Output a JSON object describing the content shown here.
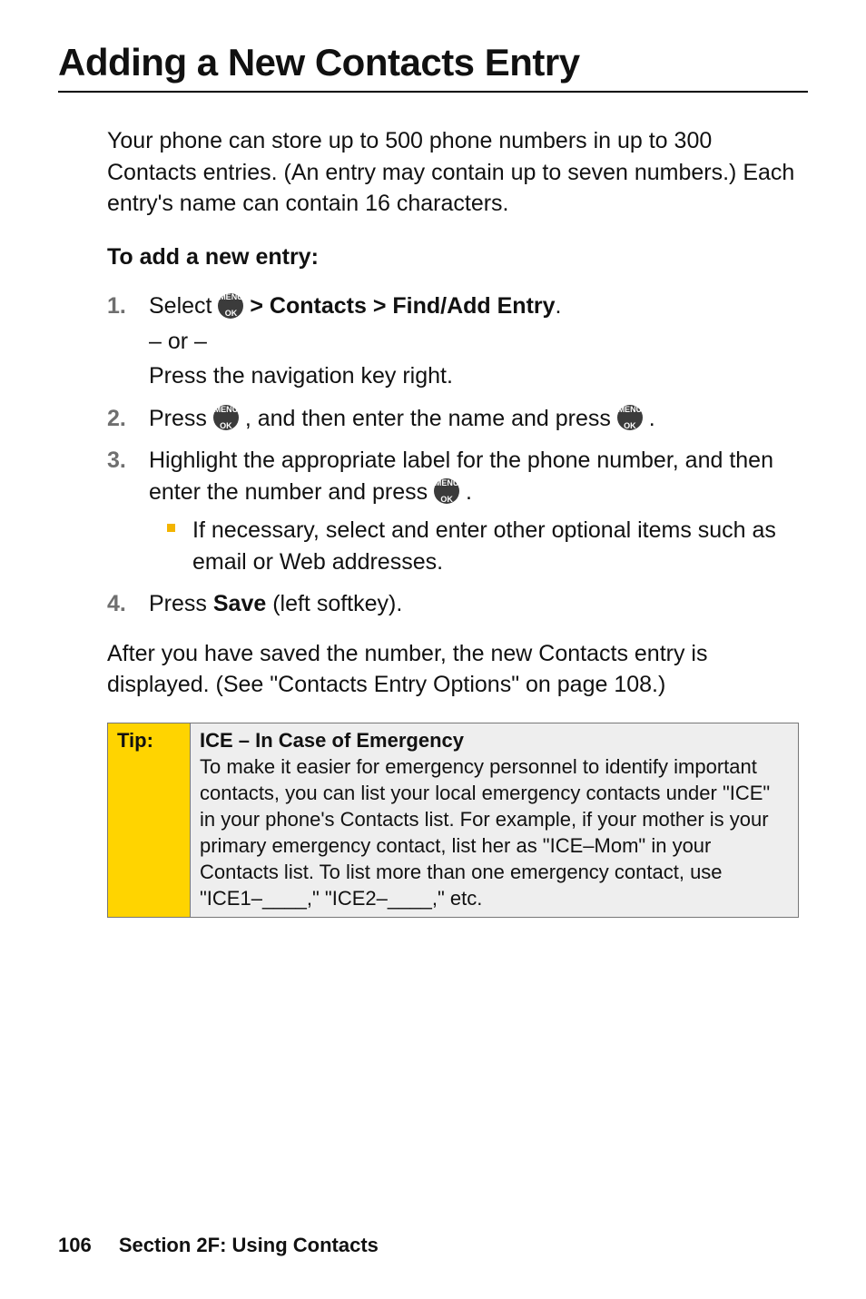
{
  "title": "Adding a New Contacts Entry",
  "intro": "Your phone can store up to 500 phone numbers in up to 300 Contacts entries. (An entry may contain up to seven numbers.) Each entry's name can contain 16 characters.",
  "subhead": "To add a new entry:",
  "icon": {
    "top": "MENU",
    "bottom": "OK"
  },
  "steps": {
    "one_a": "Select ",
    "one_b": " > Contacts > Find/Add Entry",
    "one_c": ".",
    "one_or": "– or –",
    "one_d": "Press the navigation key right.",
    "two_a": "Press ",
    "two_b": " , and then enter the name and press ",
    "two_c": " .",
    "three_a": "Highlight the appropriate label for the phone number, and then enter the number and press ",
    "three_b": " .",
    "three_nested": "If necessary, select and enter other optional items such as email or Web addresses.",
    "four_a": "Press ",
    "four_b": "Save",
    "four_c": " (left softkey)."
  },
  "after_para": "After you have saved the number, the new Contacts entry is displayed. (See \"Contacts Entry Options\" on page 108.)",
  "tip": {
    "label": "Tip:",
    "title": "ICE – In Case of Emergency",
    "body": "To make it easier for emergency personnel to identify important contacts, you can list your local emergency contacts under \"ICE\" in your phone's Contacts list. For example, if your mother is your primary emergency contact, list her as \"ICE–Mom\" in your Contacts list. To list more than one emergency contact, use \"ICE1–____,\" \"ICE2–____,\" etc."
  },
  "footer": {
    "page": "106",
    "section": "Section 2F: Using Contacts"
  }
}
